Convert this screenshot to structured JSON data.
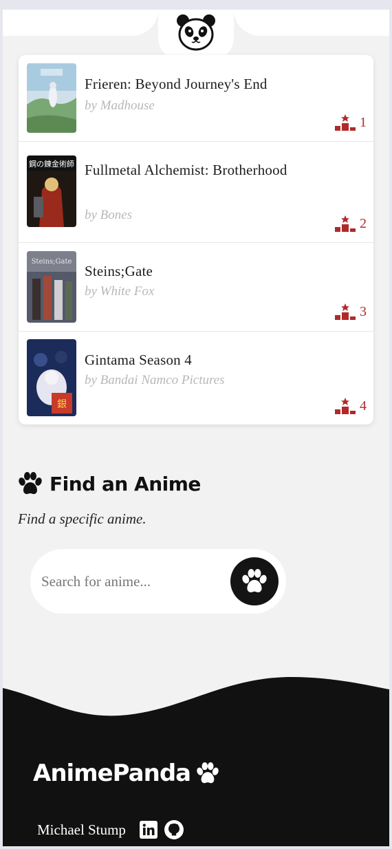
{
  "header": {
    "logo_icon": "panda-icon"
  },
  "top_list": [
    {
      "title": "Frieren: Beyond Journey's End",
      "studio": "by Madhouse",
      "rank": "1",
      "poster_colors": [
        "#8fb7a2",
        "#6f9d6a",
        "#c4d8e2"
      ]
    },
    {
      "title": "Fullmetal Alchemist: Brotherhood",
      "studio": "by Bones",
      "rank": "2",
      "poster_colors": [
        "#2a1e18",
        "#b0301f",
        "#d9b36b"
      ]
    },
    {
      "title": "Steins;Gate",
      "studio": "by White Fox",
      "rank": "3",
      "poster_colors": [
        "#4a4f5a",
        "#8a8b8f",
        "#a04a3a"
      ]
    },
    {
      "title": "Gintama Season 4",
      "studio": "by Bandai Namco Pictures",
      "rank": "4",
      "poster_colors": [
        "#1b2b5a",
        "#d8d8e8",
        "#c83a2a"
      ]
    }
  ],
  "find": {
    "title": "Find an Anime",
    "subtitle": "Find a specific anime.",
    "search_placeholder": "Search for anime...",
    "search_button_icon": "paw-icon"
  },
  "footer": {
    "brand": "AnimePanda",
    "credits": [
      {
        "name": "Michael Stump",
        "icons": [
          "linkedin-icon",
          "github-icon"
        ]
      }
    ]
  },
  "colors": {
    "accent": "#b02a2a",
    "dark": "#111111",
    "background": "#f2f2f2"
  }
}
